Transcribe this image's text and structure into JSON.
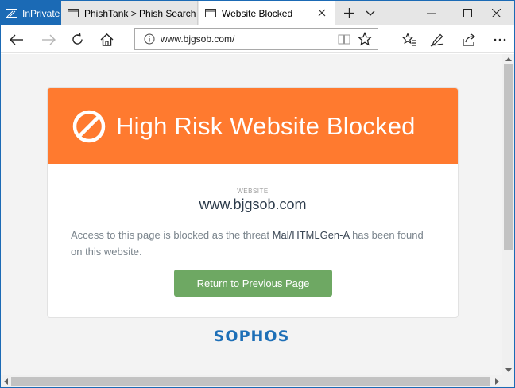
{
  "tabbar": {
    "inprivate_label": "InPrivate",
    "tabs": [
      {
        "label": "PhishTank > Phish Search",
        "icon": "page-icon",
        "active": false
      },
      {
        "label": "Website Blocked",
        "icon": "page-icon",
        "active": true
      }
    ],
    "new_tab_icon": "plus-icon",
    "tab_list_icon": "chevron-down-icon",
    "window_controls": [
      "minimize-icon",
      "maximize-icon",
      "close-icon"
    ]
  },
  "navbar": {
    "url": "www.bjgsob.com/",
    "icons": [
      "back-arrow-icon",
      "forward-arrow-icon",
      "refresh-icon",
      "home-icon",
      "info-icon",
      "reading-view-icon",
      "favorite-star-icon",
      "favorites-hub-icon",
      "pen-icon",
      "share-icon",
      "more-icon"
    ]
  },
  "page": {
    "header_title": "High Risk Website Blocked",
    "website_label": "WEBSITE",
    "website": "www.bjgsob.com",
    "message_before": "Access to this page is blocked as the threat ",
    "threat_name": "Mal/HTMLGen-A",
    "message_after": " has been found on this website.",
    "return_button": "Return to Previous Page",
    "brand": "SOPHOS"
  },
  "colors": {
    "header_orange": "#ff7a2f",
    "button_green": "#6ea863",
    "brand_blue": "#1d6fb7",
    "inprivate_blue": "#1b6ab5"
  }
}
